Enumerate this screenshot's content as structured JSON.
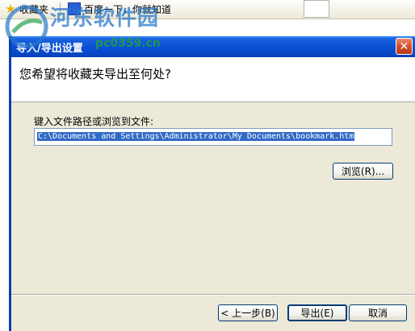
{
  "browser": {
    "favorites_label": "收藏夹",
    "bookmark_label": "百度一下，你就知道"
  },
  "watermark": {
    "title": "河东软件园",
    "url": "pc0359.cn"
  },
  "dialog": {
    "title": "导入/导出设置",
    "heading": "您希望将收藏夹导出至何处?",
    "path_label": "键入文件路径或浏览到文件:",
    "path_value": "C:\\Documents and Settings\\Administrator\\My Documents\\bookmark.htm",
    "browse_label": "浏览(R)...",
    "back_label": "< 上一步(B)",
    "export_label": "导出(E)",
    "cancel_label": "取消",
    "close_glyph": "✕"
  }
}
